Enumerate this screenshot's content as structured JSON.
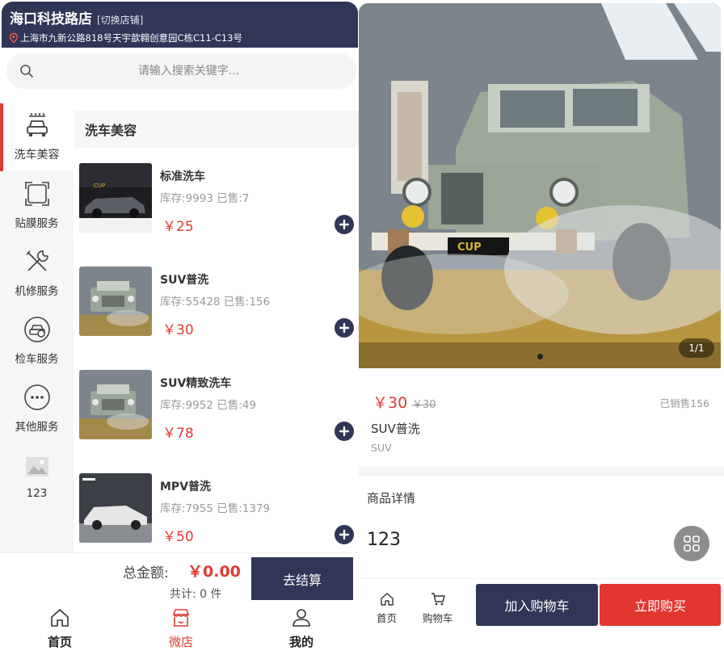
{
  "store": {
    "name": "海口科技路店",
    "switch_label": "[切换店铺]",
    "address": "上海市九新公路818号天宇歆翱创意园C栋C11-C13号"
  },
  "search": {
    "placeholder": "请输入搜索关键字..."
  },
  "categories": [
    {
      "label": "洗车美容",
      "icon": "car-wash-icon",
      "active": true
    },
    {
      "label": "贴膜服务",
      "icon": "film-frame-icon",
      "active": false
    },
    {
      "label": "机修服务",
      "icon": "tools-icon",
      "active": false
    },
    {
      "label": "检车服务",
      "icon": "car-inspection-icon",
      "active": false
    },
    {
      "label": "其他服务",
      "icon": "more-dots-icon",
      "active": false
    },
    {
      "label": "123",
      "icon": "image-icon",
      "active": false
    }
  ],
  "category_title": "洗车美容",
  "products": [
    {
      "name": "标准洗车",
      "stock": "库存:9993 已售:7",
      "price": "￥25"
    },
    {
      "name": "SUV普洗",
      "stock": "库存:55428 已售:156",
      "price": "￥30"
    },
    {
      "name": "SUV精致洗车",
      "stock": "库存:9952 已售:49",
      "price": "￥78"
    },
    {
      "name": "MPV普洗",
      "stock": "库存:7955 已售:1379",
      "price": "￥50"
    }
  ],
  "cart": {
    "total_label": "总金额:",
    "total_value": "￥0.00",
    "count": "共计: 0 件",
    "checkout": "去结算"
  },
  "tabbar": [
    {
      "label": "首页",
      "icon": "home-icon",
      "active": false
    },
    {
      "label": "微店",
      "icon": "shop-icon",
      "active": true
    },
    {
      "label": "我的",
      "icon": "user-icon",
      "active": false
    }
  ],
  "detail": {
    "page_indicator": "1/1",
    "price": "￥30",
    "old_price": "￥30",
    "sold": "已销售156",
    "name": "SUV普洗",
    "subtitle": "SUV",
    "section_title": "商品详情",
    "section_text": "123"
  },
  "action_bar": {
    "home": "首页",
    "cart": "购物车",
    "add_to_cart": "加入购物车",
    "buy_now": "立即购买"
  },
  "colors": {
    "brand_navy": "#2f3656",
    "accent_red": "#e03a33"
  }
}
